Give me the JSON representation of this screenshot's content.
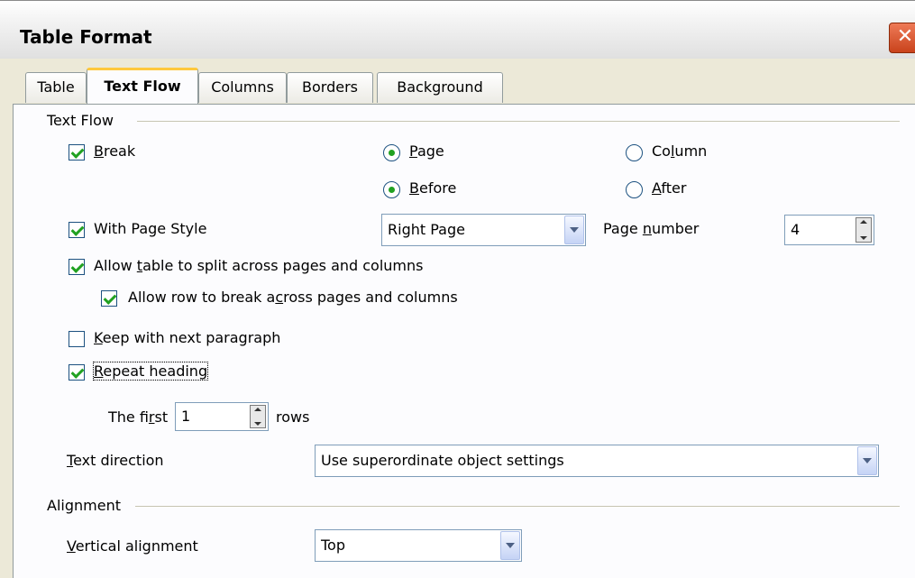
{
  "window": {
    "title": "Table Format",
    "close_icon": "close-icon",
    "close_color": "#d6502b"
  },
  "tabs": [
    {
      "label": "Table",
      "active": false
    },
    {
      "label": "Text Flow",
      "active": true
    },
    {
      "label": "Columns",
      "active": false
    },
    {
      "label": "Borders",
      "active": false
    },
    {
      "label": "Background",
      "active": false
    }
  ],
  "text_flow": {
    "group_label": "Text Flow",
    "break": {
      "label_pre": "",
      "label_u": "B",
      "label_post": "reak",
      "checked": true
    },
    "page_radio": {
      "label_pre": "",
      "label_u": "P",
      "label_post": "age",
      "checked": true
    },
    "column_radio": {
      "label_pre": "Co",
      "label_u": "l",
      "label_post": "umn",
      "checked": false
    },
    "before_radio": {
      "label_pre": "",
      "label_u": "B",
      "label_post": "efore",
      "checked": true
    },
    "after_radio": {
      "label_pre": "",
      "label_u": "A",
      "label_post": "fter",
      "checked": false
    },
    "with_page_style": {
      "label": "With Page Style",
      "checked": true
    },
    "page_style_value": "Right Page",
    "page_number_label_pre": "Page ",
    "page_number_label_u": "n",
    "page_number_label_post": "umber",
    "page_number_value": "4",
    "allow_split": {
      "label_pre": "Allow ",
      "label_u": "t",
      "label_post": "able to split across pages and columns",
      "checked": true
    },
    "allow_row_break": {
      "label_pre": "Allow row to break a",
      "label_u": "c",
      "label_post": "ross pages and columns",
      "checked": true
    },
    "keep_next": {
      "label_pre": "",
      "label_u": "K",
      "label_post": "eep with next paragraph",
      "checked": false
    },
    "repeat_heading": {
      "label_pre": "",
      "label_u": "R",
      "label_post": "epeat heading",
      "checked": true
    },
    "first_label_pre": "The fi",
    "first_label_u": "r",
    "first_label_post": "st",
    "first_value": "1",
    "rows_label": "rows",
    "text_direction_label_pre": "",
    "text_direction_label_u": "T",
    "text_direction_label_post": "ext direction",
    "text_direction_value": "Use superordinate object settings"
  },
  "alignment": {
    "group_label": "Alignment",
    "vertical_label_pre": "",
    "vertical_label_u": "V",
    "vertical_label_post": "ertical alignment",
    "vertical_value": "Top"
  },
  "colors": {
    "dialog_bg": "#ece9d8",
    "panel_bg": "#fcfcfe",
    "active_tab_accent": "#ffc83c",
    "check_green": "#21a121"
  }
}
